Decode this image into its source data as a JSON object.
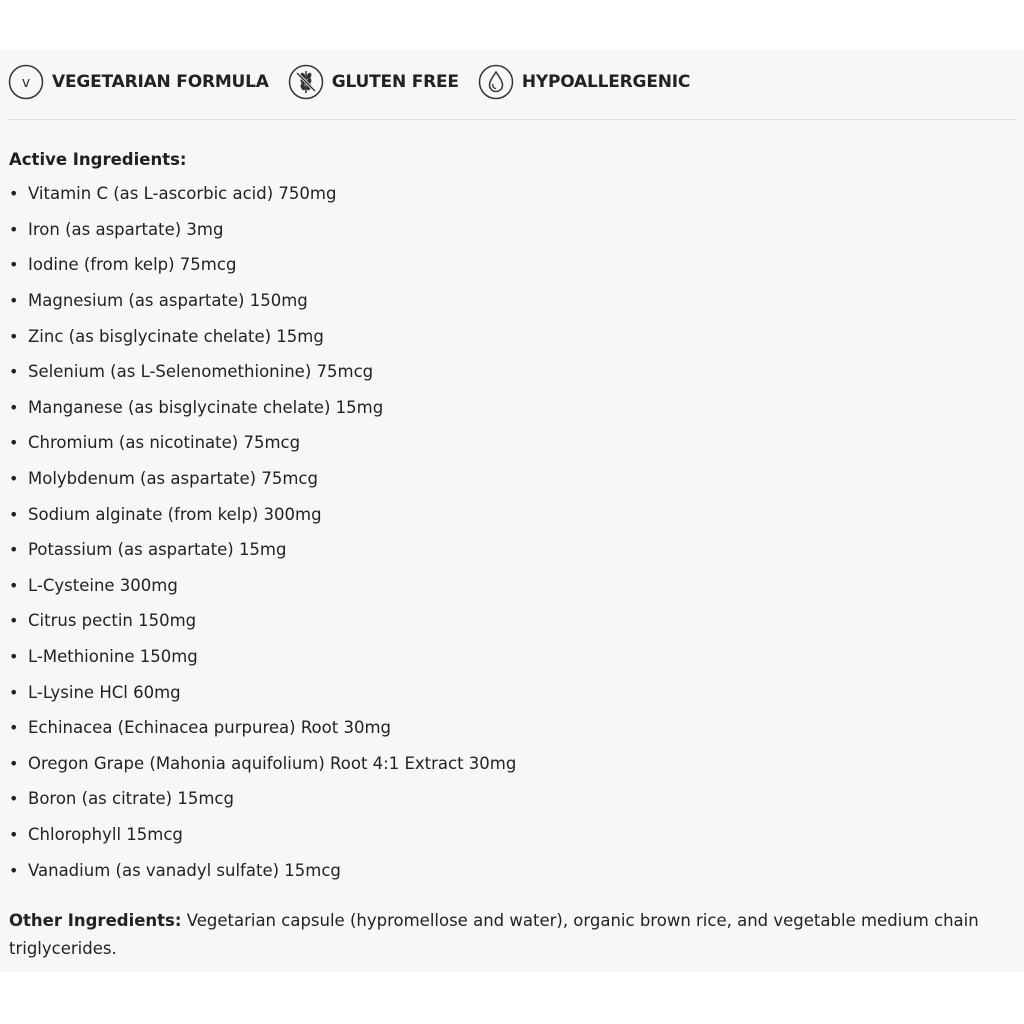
{
  "badges": [
    {
      "icon": "vegetarian-v-icon",
      "label": "VEGETARIAN FORMULA"
    },
    {
      "icon": "wheat-crossed-icon",
      "label": "GLUTEN FREE"
    },
    {
      "icon": "drop-icon",
      "label": "HYPOALLERGENIC"
    }
  ],
  "active": {
    "heading": "Active Ingredients:",
    "items": [
      "Vitamin C (as L-ascorbic acid) 750mg",
      "Iron (as aspartate) 3mg",
      "Iodine (from kelp) 75mcg",
      "Magnesium (as aspartate) 150mg",
      "Zinc (as bisglycinate chelate) 15mg",
      "Selenium (as L-Selenomethionine) 75mcg",
      "Manganese (as bisglycinate chelate) 15mg",
      "Chromium (as nicotinate) 75mcg",
      "Molybdenum (as aspartate) 75mcg",
      "Sodium alginate (from kelp) 300mg",
      "Potassium (as aspartate) 15mg",
      "L-Cysteine 300mg",
      "Citrus pectin 150mg",
      "L-Methionine 150mg",
      "L-Lysine HCl 60mg",
      "Echinacea (Echinacea purpurea) Root 30mg",
      "Oregon Grape (Mahonia aquifolium) Root 4:1 Extract 30mg",
      "Boron (as citrate) 15mcg",
      "Chlorophyll 15mcg",
      "Vanadium (as vanadyl sulfate) 15mcg"
    ]
  },
  "other": {
    "label": "Other Ingredients:",
    "text": " Vegetarian capsule (hypromellose and water), organic brown rice, and vegetable medium chain triglycerides."
  }
}
